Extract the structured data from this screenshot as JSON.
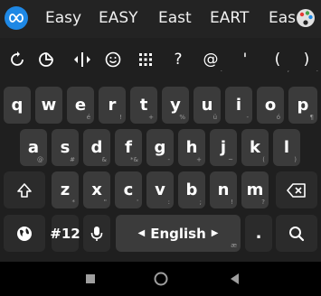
{
  "suggestions": [
    "Easy",
    "EASY",
    "East",
    "EART",
    "Eas"
  ],
  "icons": {
    "app_logo": "infinity-logo-icon",
    "theme": "palette-icon",
    "sync": "sync-icon",
    "sticker": "sticker-icon",
    "text_edit": "cursor-move-icon",
    "emoji": "emoji-icon",
    "numpad": "numpad-icon",
    "globe": "globe-icon",
    "mic": "microphone-icon",
    "shift": "shift-icon",
    "backspace": "backspace-icon",
    "search": "search-icon"
  },
  "symbols_row": [
    {
      "key": "?",
      "sup": "",
      "sub": ""
    },
    {
      "key": "@",
      "sup": "",
      "sub": "."
    },
    {
      "key": "'",
      "sup": "",
      "sub": ""
    },
    {
      "key": "(",
      "sup": "",
      "sub": ","
    },
    {
      "key": ")",
      "sup": "",
      "sub": "."
    }
  ],
  "rows": {
    "row1": [
      {
        "label": "q",
        "hint": ""
      },
      {
        "label": "w",
        "hint": ""
      },
      {
        "label": "e",
        "hint": "é"
      },
      {
        "label": "r",
        "hint": "!"
      },
      {
        "label": "t",
        "hint": "+"
      },
      {
        "label": "y",
        "hint": "%"
      },
      {
        "label": "u",
        "hint": "ü"
      },
      {
        "label": "i",
        "hint": "-"
      },
      {
        "label": "o",
        "hint": "ó"
      },
      {
        "label": "p",
        "hint": "¶"
      }
    ],
    "row2": [
      {
        "label": "a",
        "hint": "@"
      },
      {
        "label": "s",
        "hint": "#"
      },
      {
        "label": "d",
        "hint": "&"
      },
      {
        "label": "f",
        "hint": "*&"
      },
      {
        "label": "g",
        "hint": "-"
      },
      {
        "label": "h",
        "hint": "+"
      },
      {
        "label": "j",
        "hint": "~"
      },
      {
        "label": "k",
        "hint": "("
      },
      {
        "label": "l",
        "hint": ")"
      }
    ],
    "row3": [
      {
        "label": "z",
        "hint": "*"
      },
      {
        "label": "x",
        "hint": "\""
      },
      {
        "label": "c",
        "hint": "'"
      },
      {
        "label": "v",
        "hint": ":"
      },
      {
        "label": "b",
        "hint": ";"
      },
      {
        "label": "n",
        "hint": "!"
      },
      {
        "label": "m",
        "hint": "?"
      }
    ]
  },
  "bottom_row": {
    "numbers_label": "#12",
    "space_label": "English",
    "space_hint": "æ",
    "period_label": "."
  },
  "accent_color": "#1e88e5"
}
